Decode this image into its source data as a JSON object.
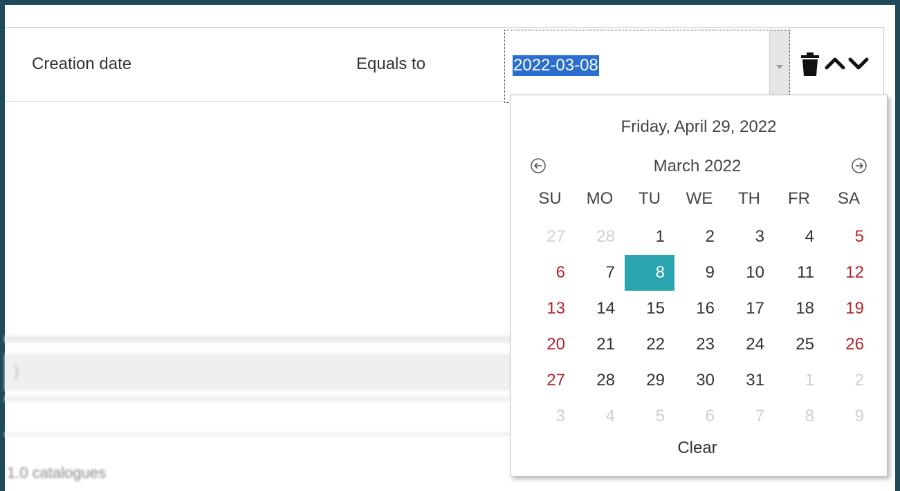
{
  "filter": {
    "field": "Creation date",
    "operator": "Equals to",
    "value": "2022-03-08"
  },
  "background": {
    "row_glyph": ")",
    "footer_text": "1.0 catalogues"
  },
  "calendar": {
    "today_header": "Friday, April 29, 2022",
    "month_title": "March 2022",
    "weekdays": [
      "SU",
      "MO",
      "TU",
      "WE",
      "TH",
      "FR",
      "SA"
    ],
    "weeks": [
      [
        "27",
        "28",
        "1",
        "2",
        "3",
        "4",
        "5"
      ],
      [
        "6",
        "7",
        "8",
        "9",
        "10",
        "11",
        "12"
      ],
      [
        "13",
        "14",
        "15",
        "16",
        "17",
        "18",
        "19"
      ],
      [
        "20",
        "21",
        "22",
        "23",
        "24",
        "25",
        "26"
      ],
      [
        "27",
        "28",
        "29",
        "30",
        "31",
        "1",
        "2"
      ],
      [
        "3",
        "4",
        "5",
        "6",
        "7",
        "8",
        "9"
      ]
    ],
    "selected_day": "8",
    "clear_label": "Clear",
    "colors": {
      "selected_bg": "#2ca5b0",
      "weekend": "#b2242c",
      "other_month": "#cfcfcf",
      "selection_highlight": "#2a6fd0",
      "frame": "#1e4a5c"
    }
  }
}
